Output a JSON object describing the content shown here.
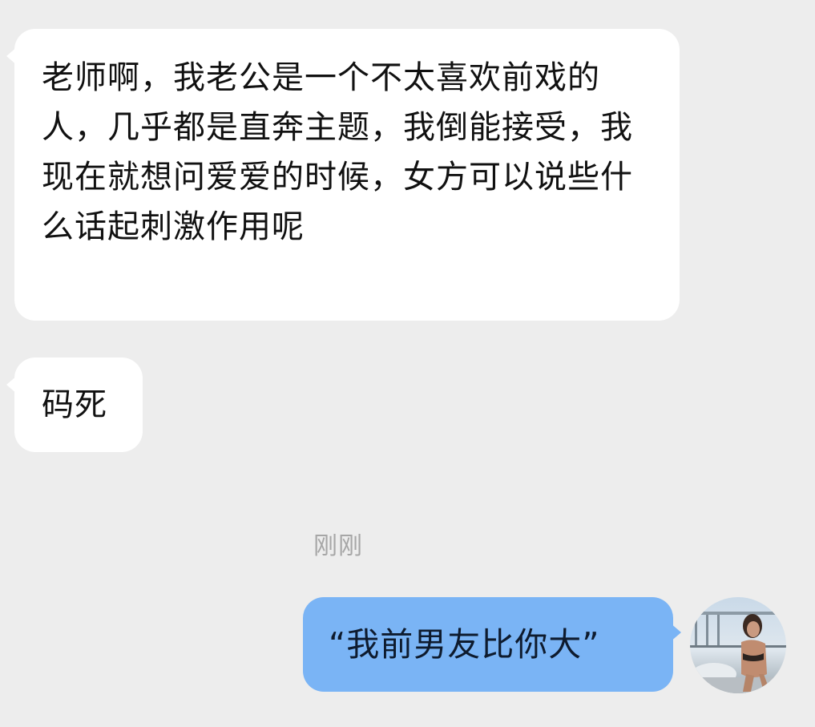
{
  "conversation": {
    "messages": [
      {
        "side": "incoming",
        "text": "老师啊，我老公是一个不太喜欢前戏的人，几乎都是直奔主题，我倒能接受，我现在就想问爱爱的时候，女方可以说些什么话起刺激作用呢"
      },
      {
        "side": "incoming",
        "text": "码死"
      },
      {
        "side": "outgoing",
        "text": "“我前男友比你大”"
      }
    ],
    "timestamp": "刚刚"
  },
  "colors": {
    "background": "#ededed",
    "incoming_bubble": "#ffffff",
    "outgoing_bubble": "#7ab4f5",
    "timestamp_text": "#a6a6a6"
  },
  "icons": {
    "avatar": "user-avatar-photo"
  }
}
